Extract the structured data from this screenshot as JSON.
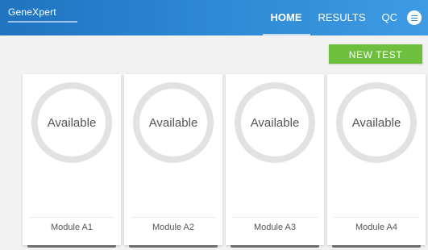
{
  "header": {
    "logo": "GeneXpert",
    "nav": [
      {
        "label": "HOME",
        "active": true
      },
      {
        "label": "RESULTS",
        "active": false
      },
      {
        "label": "QC",
        "active": false
      }
    ],
    "menu_icon": "menu-icon",
    "colors": {
      "header_left": "#1f73bf",
      "header_right": "#3e9be3"
    }
  },
  "actions": {
    "new_test_label": "NEW TEST",
    "new_test_color": "#6fbf3f"
  },
  "modules": [
    {
      "status": "Available",
      "name": "Module A1"
    },
    {
      "status": "Available",
      "name": "Module A2"
    },
    {
      "status": "Available",
      "name": "Module A3"
    },
    {
      "status": "Available",
      "name": "Module A4"
    }
  ]
}
